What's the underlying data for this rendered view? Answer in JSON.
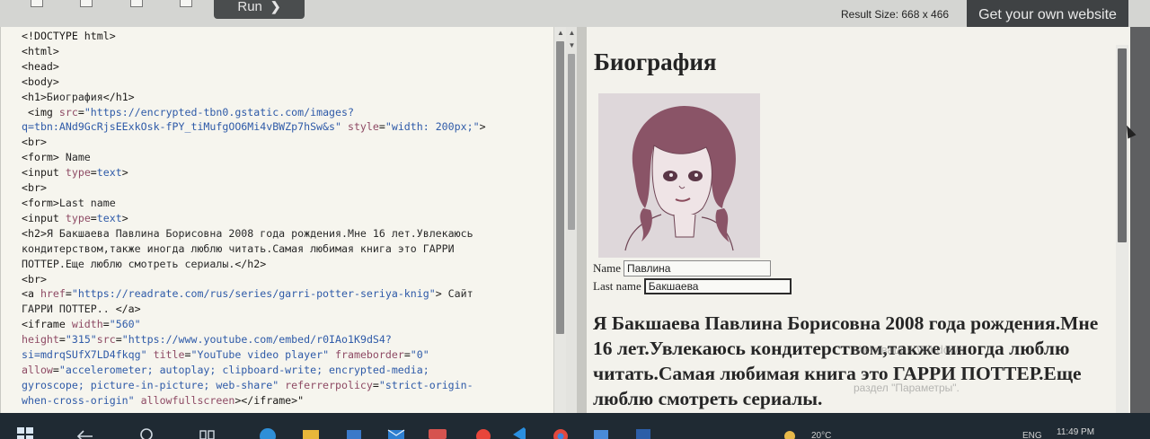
{
  "toolbar": {
    "run_label": "Run",
    "run_chevron": "❯",
    "result_size": "Result Size: 668 x 466",
    "get_website_label": "Get your own website"
  },
  "editor": {
    "lines": [
      [
        {
          "t": "tag",
          "v": "<!DOCTYPE html>"
        }
      ],
      [
        {
          "t": "tag",
          "v": "<html>"
        }
      ],
      [
        {
          "t": "tag",
          "v": "<head>"
        }
      ],
      [
        {
          "t": "tag",
          "v": "<body>"
        }
      ],
      [
        {
          "t": "tag",
          "v": "<h1>"
        },
        {
          "t": "txt",
          "v": "Биография"
        },
        {
          "t": "tag",
          "v": "</h1>"
        }
      ],
      [
        {
          "t": "tag",
          "v": " <img "
        },
        {
          "t": "attr",
          "v": "src"
        },
        {
          "t": "tag",
          "v": "="
        },
        {
          "t": "val",
          "v": "\"https://encrypted-tbn0.gstatic.com/images?"
        }
      ],
      [
        {
          "t": "val",
          "v": "q=tbn:ANd9GcRjsEExkOsk-fPY_tiMufgOO6Mi4vBWZp7hSw&s\""
        },
        {
          "t": "tag",
          "v": " "
        },
        {
          "t": "attr",
          "v": "style"
        },
        {
          "t": "tag",
          "v": "="
        },
        {
          "t": "val",
          "v": "\"width: 200px;\""
        },
        {
          "t": "tag",
          "v": ">"
        }
      ],
      [
        {
          "t": "tag",
          "v": "<br>"
        }
      ],
      [
        {
          "t": "tag",
          "v": "<form>"
        },
        {
          "t": "txt",
          "v": " Name"
        }
      ],
      [
        {
          "t": "tag",
          "v": "<input "
        },
        {
          "t": "attr",
          "v": "type"
        },
        {
          "t": "tag",
          "v": "="
        },
        {
          "t": "val",
          "v": "text"
        },
        {
          "t": "tag",
          "v": ">"
        }
      ],
      [
        {
          "t": "tag",
          "v": "<br>"
        }
      ],
      [
        {
          "t": "tag",
          "v": "<form>"
        },
        {
          "t": "txt",
          "v": "Last name"
        }
      ],
      [
        {
          "t": "tag",
          "v": "<input "
        },
        {
          "t": "attr",
          "v": "type"
        },
        {
          "t": "tag",
          "v": "="
        },
        {
          "t": "val",
          "v": "text"
        },
        {
          "t": "tag",
          "v": ">"
        }
      ],
      [
        {
          "t": "tag",
          "v": "<h2>"
        },
        {
          "t": "txt",
          "v": "Я Бакшаева Павлина Борисовна 2008 года рождения.Мне 16 лет.Увлекаюсь"
        }
      ],
      [
        {
          "t": "txt",
          "v": "кондитерством,также иногда люблю читать.Самая любимая книга это ГАРРИ"
        }
      ],
      [
        {
          "t": "txt",
          "v": "ПОТТЕР.Еще люблю смотреть сериалы."
        },
        {
          "t": "tag",
          "v": "</h2>"
        }
      ],
      [
        {
          "t": "tag",
          "v": "<br>"
        }
      ],
      [
        {
          "t": "tag",
          "v": "<a "
        },
        {
          "t": "attr",
          "v": "href"
        },
        {
          "t": "tag",
          "v": "="
        },
        {
          "t": "val",
          "v": "\"https://readrate.com/rus/series/garri-potter-seriya-knig\""
        },
        {
          "t": "tag",
          "v": ">"
        },
        {
          "t": "txt",
          "v": " Сайт"
        }
      ],
      [
        {
          "t": "txt",
          "v": "ГАРРИ ПОТТЕР.. "
        },
        {
          "t": "tag",
          "v": "</a>"
        }
      ],
      [
        {
          "t": "tag",
          "v": "<iframe "
        },
        {
          "t": "attr",
          "v": "width"
        },
        {
          "t": "tag",
          "v": "="
        },
        {
          "t": "val",
          "v": "\"560\""
        }
      ],
      [
        {
          "t": "attr",
          "v": "height"
        },
        {
          "t": "tag",
          "v": "="
        },
        {
          "t": "val",
          "v": "\"315\""
        },
        {
          "t": "attr",
          "v": "src"
        },
        {
          "t": "tag",
          "v": "="
        },
        {
          "t": "val",
          "v": "\"https://www.youtube.com/embed/r0IAo1K9dS4?"
        }
      ],
      [
        {
          "t": "val",
          "v": "si=mdrqSUfX7LD4fkqg\""
        },
        {
          "t": "tag",
          "v": " "
        },
        {
          "t": "attr",
          "v": "title"
        },
        {
          "t": "tag",
          "v": "="
        },
        {
          "t": "val",
          "v": "\"YouTube video player\""
        },
        {
          "t": "tag",
          "v": " "
        },
        {
          "t": "attr",
          "v": "frameborder"
        },
        {
          "t": "tag",
          "v": "="
        },
        {
          "t": "val",
          "v": "\"0\""
        }
      ],
      [
        {
          "t": "attr",
          "v": "allow"
        },
        {
          "t": "tag",
          "v": "="
        },
        {
          "t": "val",
          "v": "\"accelerometer; autoplay; clipboard-write; encrypted-media;"
        }
      ],
      [
        {
          "t": "val",
          "v": "gyroscope; picture-in-picture; web-share\""
        },
        {
          "t": "tag",
          "v": " "
        },
        {
          "t": "attr",
          "v": "referrerpolicy"
        },
        {
          "t": "tag",
          "v": "="
        },
        {
          "t": "val",
          "v": "\"strict-origin-"
        }
      ],
      [
        {
          "t": "val",
          "v": "when-cross-origin\""
        },
        {
          "t": "tag",
          "v": " "
        },
        {
          "t": "attr",
          "v": "allowfullscreen"
        },
        {
          "t": "tag",
          "v": "></iframe>\""
        }
      ]
    ]
  },
  "result": {
    "heading": "Биография",
    "name_label": "Name",
    "name_value": "Павлина",
    "lastname_label": "Last name",
    "lastname_value": "Бакшаева",
    "bio": "Я Бакшаева Павлина Борисовна 2008 года рождения.Мне 16 лет.Увлекаюсь кондитерством,также иногда люблю читать.Самая любимая книга это ГАРРИ ПОТТЕР.Еще люблю смотреть сериалы.",
    "watermark_line1": "Активация Windows",
    "watermark_line2": "раздел \"Параметры\"."
  },
  "taskbar": {
    "clock": "11:49 PM",
    "temp": "20°C",
    "lang": "ENG"
  },
  "colors": {
    "tag": "#1c1a18",
    "attr": "#8e4a64",
    "val": "#2e5aa8",
    "editor_bg": "#f6f5ee",
    "result_bg": "#f3f2ec",
    "toolbar_dark": "#3f4244"
  }
}
